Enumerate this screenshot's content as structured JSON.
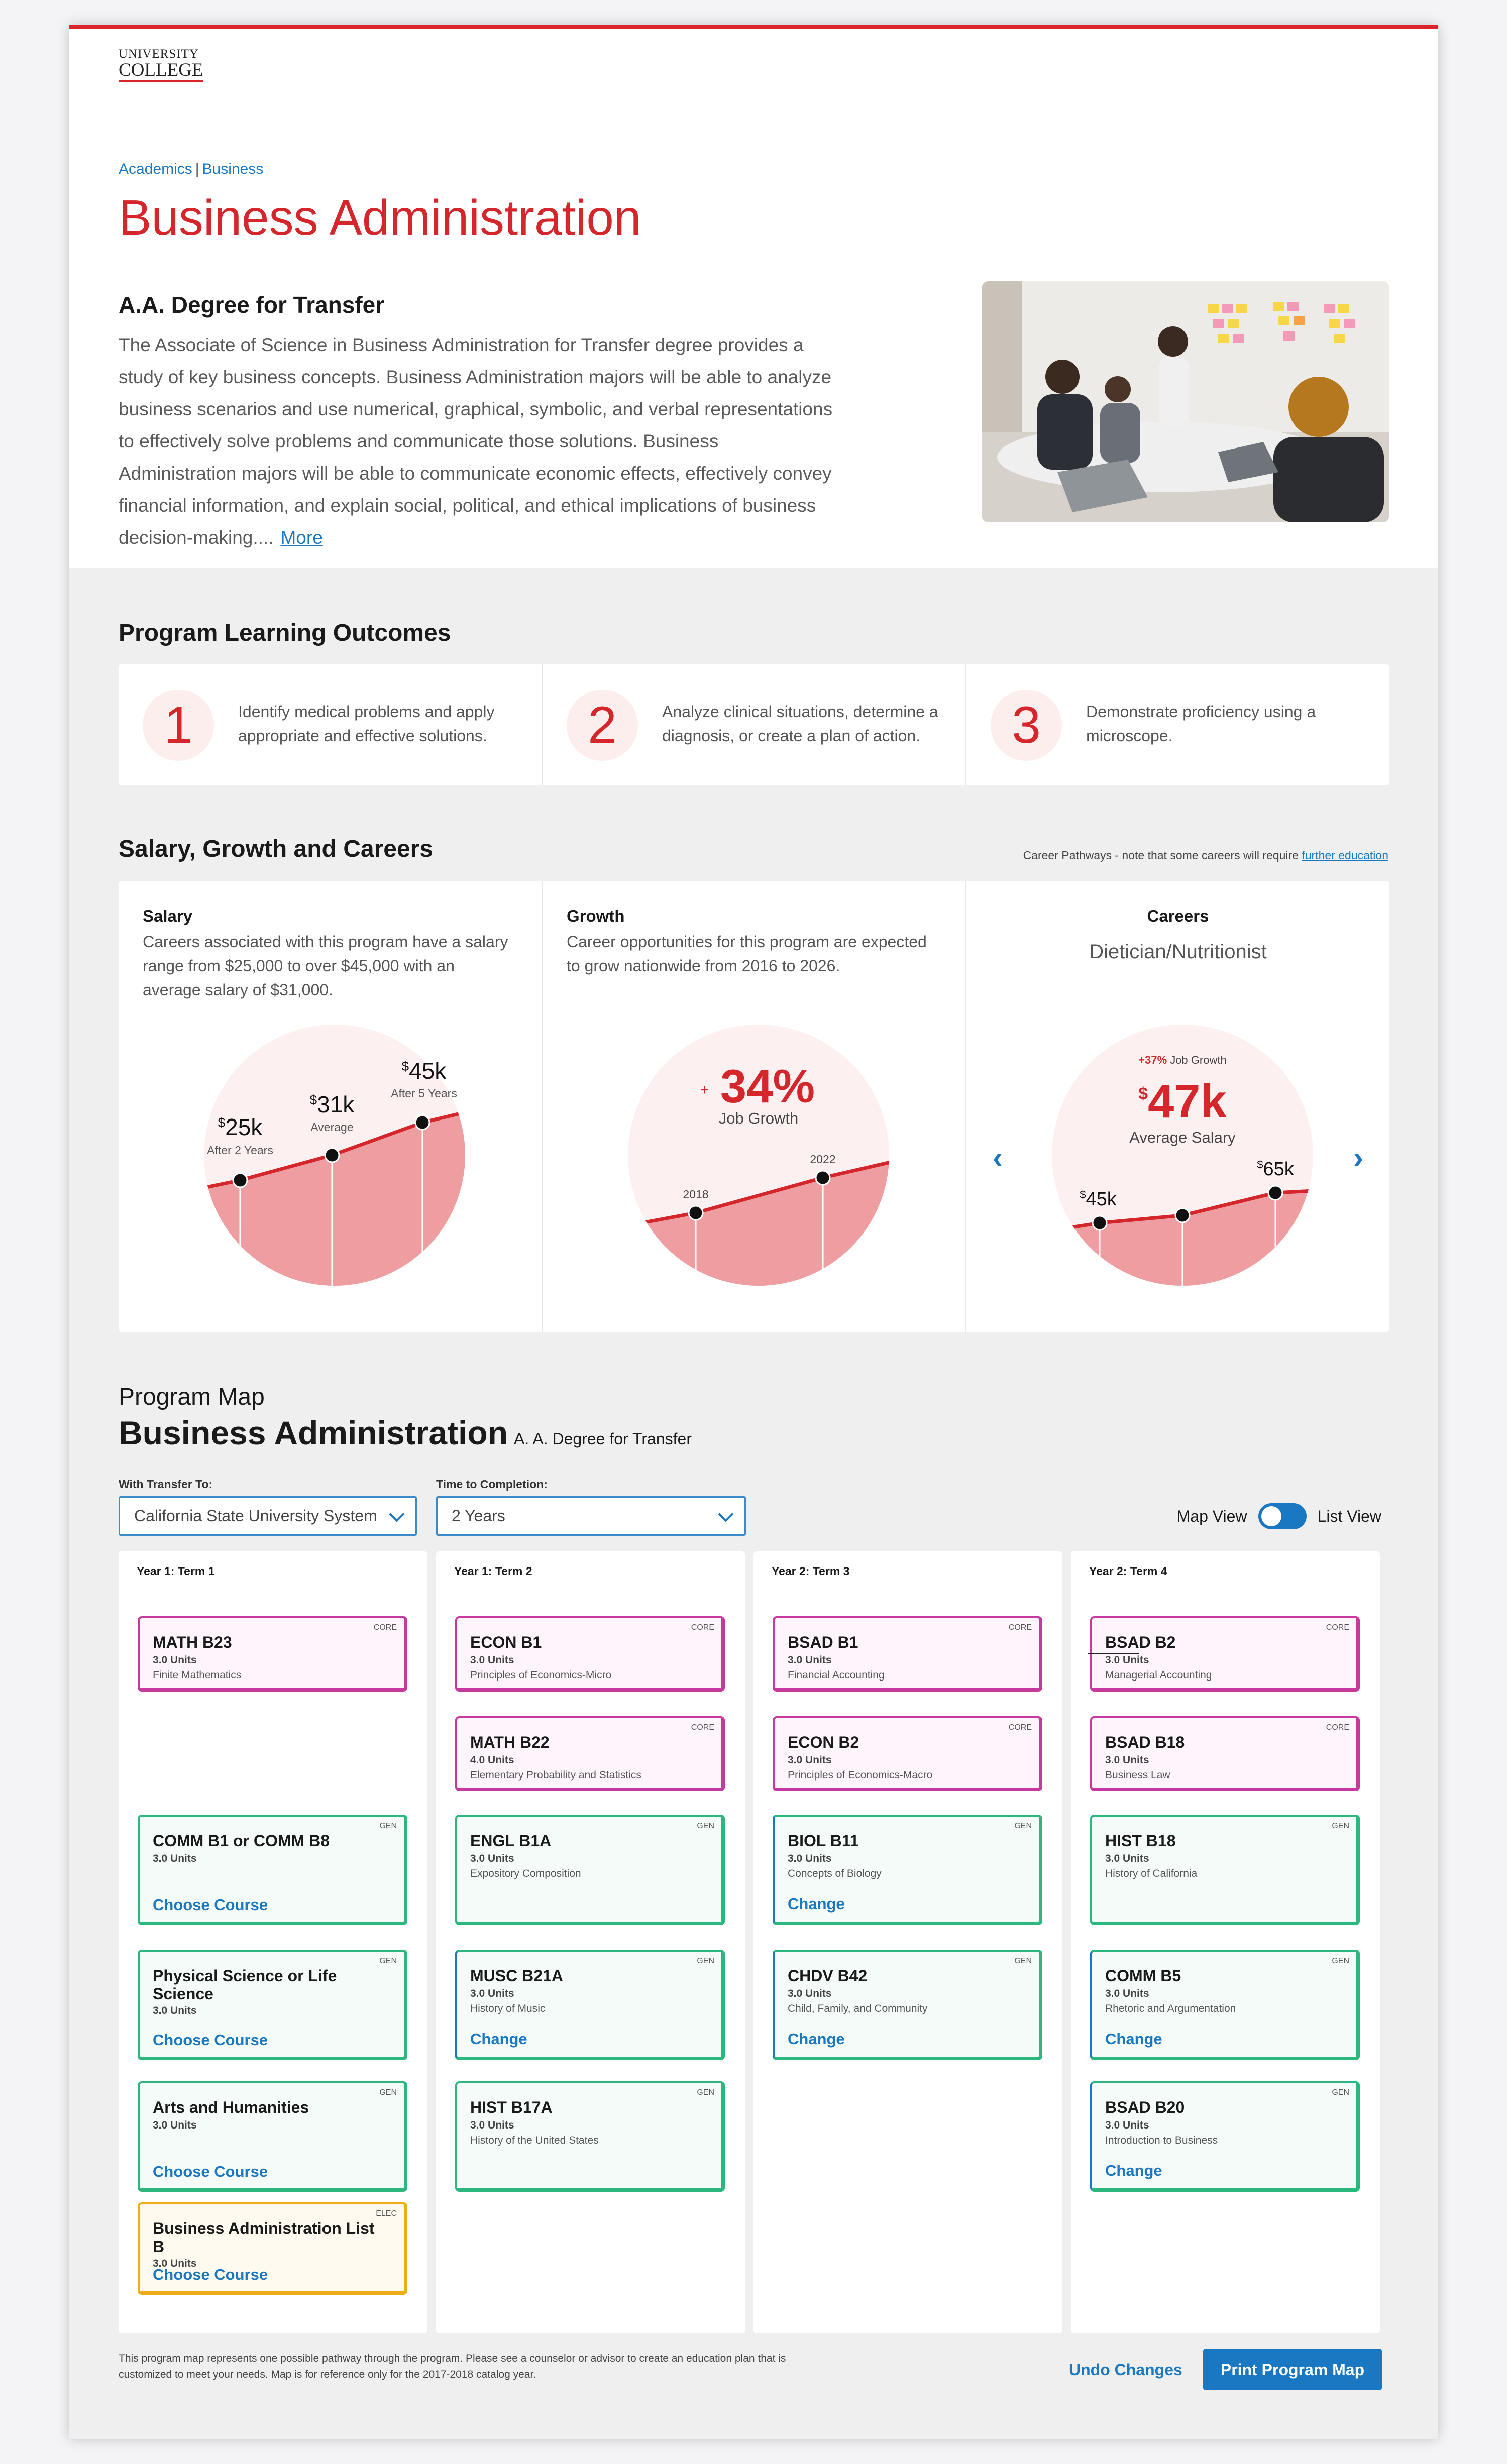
{
  "logo": {
    "line1": "UNIVERSITY",
    "line2": "COLLEGE"
  },
  "breadcrumb": {
    "items": [
      "Academics",
      "Business"
    ],
    "separator": "|"
  },
  "page_title": "Business Administration",
  "degree": {
    "subtitle": "A.A. Degree for Transfer",
    "description": "The Associate of Science in Business Administration for Transfer degree provides a study of key business concepts. Business Administration majors will be able to analyze business scenarios and use numerical, graphical, symbolic, and verbal representations to effectively solve problems and communicate those solutions. Business Administration majors will be able to communicate economic effects, effectively convey financial information, and explain social, political, and ethical implications of business decision-making....",
    "more_link": "More"
  },
  "outcomes": {
    "heading": "Program Learning Outcomes",
    "items": [
      {
        "num": "1",
        "text": "Identify medical problems and apply appropriate and effective solutions."
      },
      {
        "num": "2",
        "text": "Analyze clinical situations, determine a diagnosis, or create a plan of action."
      },
      {
        "num": "3",
        "text": "Demonstrate proficiency using a microscope."
      }
    ]
  },
  "salary_section": {
    "heading": "Salary, Growth and Careers",
    "note_prefix": "Career Pathways - note that some careers will require ",
    "note_link": "further education",
    "salary": {
      "title": "Salary",
      "text": "Careers associated with this program have a salary range from $25,000 to over $45,000 with an average salary of $31,000.",
      "points": [
        {
          "value": "25k",
          "label": "After 2 Years"
        },
        {
          "value": "31k",
          "label": "Average"
        },
        {
          "value": "45k",
          "label": "After 5 Years"
        }
      ]
    },
    "growth": {
      "title": "Growth",
      "text": "Career opportunities for this program are expected to grow nationwide from 2016 to 2026.",
      "percent": "34%",
      "plus": "+",
      "label": "Job Growth",
      "years": [
        "2018",
        "2022"
      ]
    },
    "careers": {
      "title": "Careers",
      "name": "Dietician/Nutritionist",
      "growth_value": "+37%",
      "growth_label": "Job Growth",
      "salary": "47k",
      "salary_label": "Average Salary",
      "low": "45k",
      "high": "65k",
      "prev_icon": "chevron-left-icon",
      "next_icon": "chevron-right-icon"
    }
  },
  "program_map": {
    "label": "Program Map",
    "title": "Business Administration",
    "degree": "A. A. Degree for Transfer",
    "transfer_label": "With Transfer To:",
    "transfer_value": "California State University System",
    "time_label": "Time to Completion:",
    "time_value": "2 Years",
    "map_view": "Map View",
    "list_view": "List View",
    "terms": [
      {
        "title": "Year 1: Term 1",
        "courses": [
          {
            "tag": "CORE",
            "code": "MATH B23",
            "units": "3.0 Units",
            "name": "Finite Mathematics"
          },
          {
            "tag": "GEN",
            "code": "COMM B1 or COMM B8",
            "units": "3.0 Units",
            "action": "Choose Course"
          },
          {
            "tag": "GEN",
            "code": "Physical Science or Life Science",
            "units": "3.0 Units",
            "action": "Choose Course"
          },
          {
            "tag": "GEN",
            "code": "Arts and Humanities",
            "units": "3.0 Units",
            "action": "Choose Course"
          },
          {
            "tag": "ELEC",
            "code": "Business Administration List B",
            "units": "3.0 Units",
            "action": "Choose Course"
          }
        ]
      },
      {
        "title": "Year 1: Term 2",
        "courses": [
          {
            "tag": "CORE",
            "code": "ECON B1",
            "units": "3.0 Units",
            "name": "Principles of Economics-Micro"
          },
          {
            "tag": "CORE",
            "code": "MATH B22",
            "units": "4.0 Units",
            "name": "Elementary Probability and Statistics"
          },
          {
            "tag": "GEN",
            "code": "ENGL B1A",
            "units": "3.0 Units",
            "name": "Expository Composition"
          },
          {
            "tag": "GEN",
            "code": "MUSC B21A",
            "units": "3.0 Units",
            "name": "History of Music",
            "action": "Change"
          },
          {
            "tag": "GEN",
            "code": "HIST B17A",
            "units": "3.0 Units",
            "name": "History of the United States"
          }
        ]
      },
      {
        "title": "Year 2: Term 3",
        "courses": [
          {
            "tag": "CORE",
            "code": "BSAD B1",
            "units": "3.0 Units",
            "name": "Financial Accounting"
          },
          {
            "tag": "CORE",
            "code": "ECON B2",
            "units": "3.0 Units",
            "name": "Principles of Economics-Macro"
          },
          {
            "tag": "GEN",
            "code": "BIOL B11",
            "units": "3.0 Units",
            "name": "Concepts of Biology",
            "action": "Change"
          },
          {
            "tag": "GEN",
            "code": "CHDV B42",
            "units": "3.0 Units",
            "name": "Child, Family, and Community",
            "action": "Change"
          }
        ]
      },
      {
        "title": "Year 2: Term 4",
        "courses": [
          {
            "tag": "CORE",
            "code": "BSAD B2",
            "units": "3.0 Units",
            "name": "Managerial Accounting"
          },
          {
            "tag": "CORE",
            "code": "BSAD B18",
            "units": "3.0 Units",
            "name": "Business Law"
          },
          {
            "tag": "GEN",
            "code": "HIST B18",
            "units": "3.0 Units",
            "name": "History of California"
          },
          {
            "tag": "GEN",
            "code": "COMM B5",
            "units": "3.0 Units",
            "name": "Rhetoric and Argumentation",
            "action": "Change"
          },
          {
            "tag": "GEN",
            "code": "BSAD B20",
            "units": "3.0 Units",
            "name": "Introduction to Business",
            "action": "Change"
          }
        ]
      }
    ],
    "footnote": "This program map represents one possible pathway through the program.  Please see a counselor or advisor to create an education plan that is customized to meet your needs. Map is for reference only for the 2017-2018 catalog year.",
    "undo_label": "Undo Changes",
    "print_label": "Print Program Map"
  },
  "colors": {
    "accent": "#d4262b",
    "link": "#1a78c2",
    "core": "#c53a9c",
    "gen": "#2bb77e",
    "elec": "#f0ac18"
  }
}
